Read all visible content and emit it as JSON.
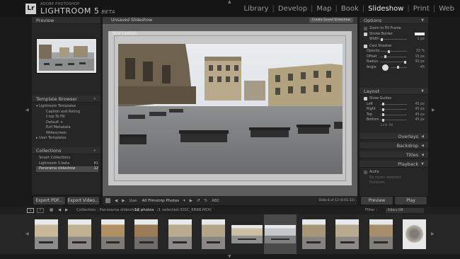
{
  "app": {
    "vendor_label": "ADOBE PHOTOSHOP",
    "name": "LIGHTROOM 5",
    "badge": "BETA",
    "logo_text": "Lr"
  },
  "modules": [
    {
      "label": "Library",
      "active": false
    },
    {
      "label": "Develop",
      "active": false
    },
    {
      "label": "Map",
      "active": false
    },
    {
      "label": "Book",
      "active": false
    },
    {
      "label": "Slideshow",
      "active": true
    },
    {
      "label": "Print",
      "active": false
    },
    {
      "label": "Web",
      "active": false
    }
  ],
  "left_panel": {
    "preview_title": "Preview",
    "template_browser_title": "Template Browser",
    "templates_group": "Lightroom Templates",
    "templates": [
      "Caption and Rating",
      "Crop To Fill",
      "Default +",
      "Exif Metadata",
      "Widescreen"
    ],
    "user_templates": "User Templates",
    "collections_title": "Collections",
    "collections": [
      {
        "name": "Smart Collections",
        "count": ""
      },
      {
        "name": "Lightroom 5 beta",
        "count": "81"
      },
      {
        "name": "Panorama slideshow",
        "count": "12"
      }
    ],
    "export_pdf": "Export PDF...",
    "export_video": "Export Video..."
  },
  "center": {
    "title": "Unsaved Slideshow",
    "create_saved": "Create Saved Slideshow",
    "slide_author": "Rod Lawton",
    "use_label": "Use:",
    "use_value": "All Filmstrip Photos",
    "abc": "ABC",
    "slide_counter": "Slide 8 of 12 (0:01:32)"
  },
  "right_panel": {
    "options_title": "Options",
    "zoom_to_fill": "Zoom to Fill Frame",
    "stroke_border": "Stroke Border",
    "width_label": "Width",
    "width_value": "1 px",
    "cast_shadow": "Cast Shadow",
    "shadow": [
      {
        "label": "Opacity",
        "value": "33 %"
      },
      {
        "label": "Offset",
        "value": "15 px"
      },
      {
        "label": "Radius",
        "value": "90 px"
      },
      {
        "label": "Angle",
        "value": "-45"
      }
    ],
    "layout_title": "Layout",
    "show_guides": "Show Guides",
    "guides": [
      {
        "label": "Left",
        "value": "45 px"
      },
      {
        "label": "Right",
        "value": "45 px"
      },
      {
        "label": "Top",
        "value": "45 px"
      },
      {
        "label": "Bottom",
        "value": "45 px"
      }
    ],
    "link_all": "Link All",
    "overlays": "Overlays",
    "backdrop": "Backdrop",
    "titles": "Titles",
    "playback": "Playback",
    "audio": "Audio",
    "no_music": "No music selected",
    "duration": "Duration:",
    "preview_btn": "Preview",
    "play_btn": "Play"
  },
  "filmstrip": {
    "monitor_1": "1",
    "monitor_2": "2",
    "path": "Collection : Panorama slideshow",
    "count": "12 photos",
    "selection": "/1 selected /DSC_6898.MOV",
    "filter_label": "Filter :",
    "filter_value": "Filters Off",
    "thumb_count": 12,
    "selected_index": 7
  }
}
